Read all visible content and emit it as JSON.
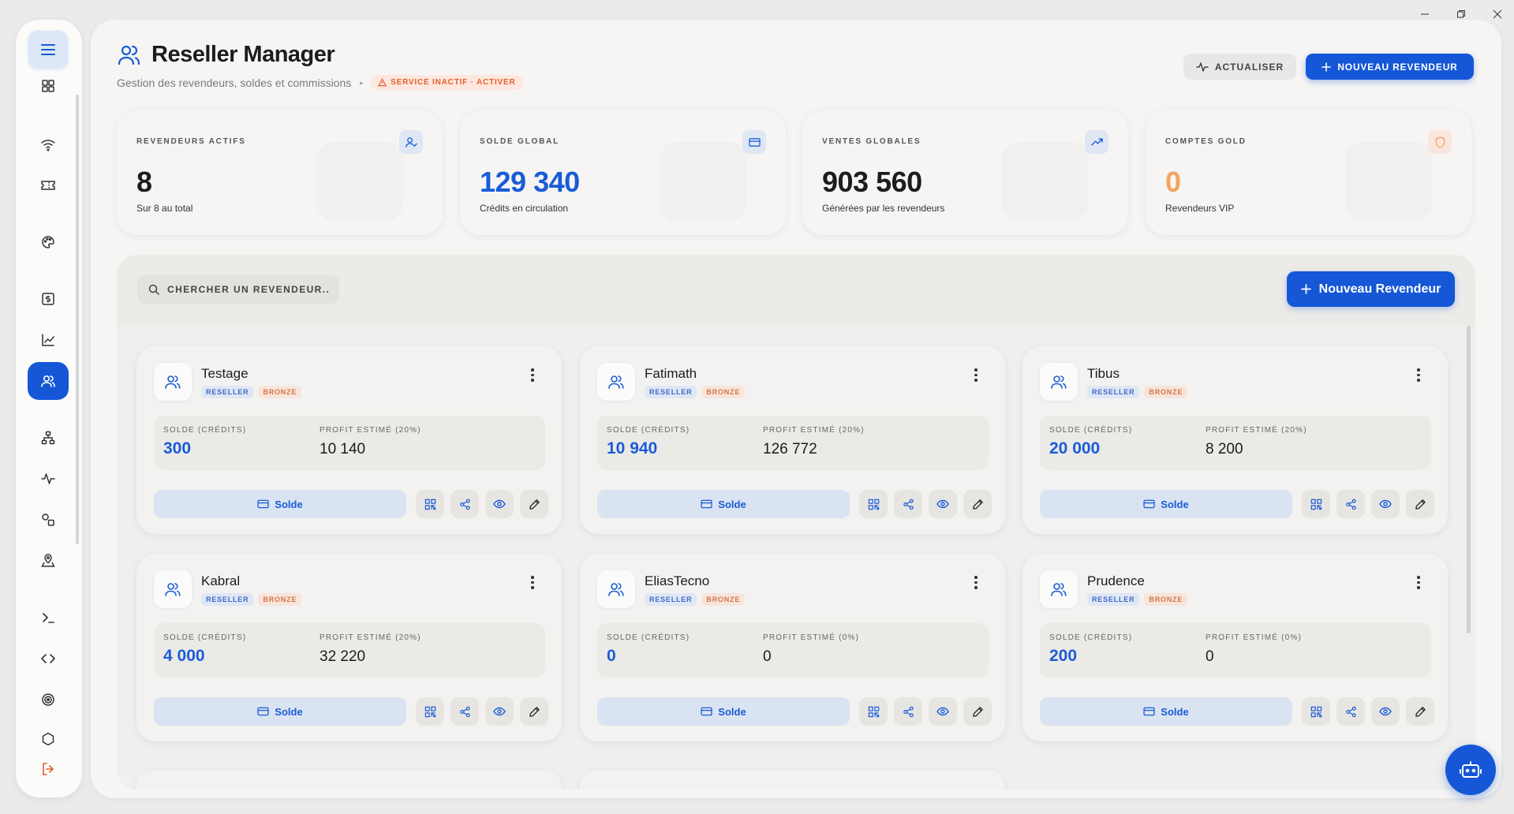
{
  "header": {
    "title": "Reseller Manager",
    "subtitle": "Gestion des revendeurs, soldes et commissions",
    "separator": "•",
    "service_badge": "SERVICE INACTIF · ACTIVER",
    "refresh_label": "ACTUALISER",
    "new_label": "NOUVEAU REVENDEUR"
  },
  "stats": [
    {
      "label": "REVENDEURS ACTIFS",
      "value": "8",
      "sub": "Sur 8 au total",
      "color": "#1c1c1c",
      "icon": "user-check-icon"
    },
    {
      "label": "SOLDE GLOBAL",
      "value": "129 340",
      "sub": "Crédits en circulation",
      "color": "#1a5cd8",
      "icon": "card-icon"
    },
    {
      "label": "VENTES GLOBALES",
      "value": "903 560",
      "sub": "Générées par les revendeurs",
      "color": "#1c1c1c",
      "icon": "trending-up-icon"
    },
    {
      "label": "COMPTES GOLD",
      "value": "0",
      "sub": "Revendeurs VIP",
      "color": "#f3a45c",
      "icon": "shield-icon"
    }
  ],
  "panel": {
    "search_placeholder": "CHERCHER UN REVENDEUR..",
    "new_button": "Nouveau Revendeur"
  },
  "labels": {
    "balance": "SOLDE (CRÉDITS)",
    "solde_button": "Solde"
  },
  "resellers": [
    {
      "name": "Testage",
      "role": "RESELLER",
      "tier": "BRONZE",
      "balance": "300",
      "profit_label": "PROFIT ESTIMÉ (20%)",
      "profit": "10 140"
    },
    {
      "name": "Fatimath",
      "role": "RESELLER",
      "tier": "BRONZE",
      "balance": "10 940",
      "profit_label": "PROFIT ESTIMÉ (20%)",
      "profit": "126 772"
    },
    {
      "name": "Tibus",
      "role": "RESELLER",
      "tier": "BRONZE",
      "balance": "20 000",
      "profit_label": "PROFIT ESTIMÉ (20%)",
      "profit": "8 200"
    },
    {
      "name": "Kabral",
      "role": "RESELLER",
      "tier": "BRONZE",
      "balance": "4 000",
      "profit_label": "PROFIT ESTIMÉ (20%)",
      "profit": "32 220"
    },
    {
      "name": "EliasTecno",
      "role": "RESELLER",
      "tier": "BRONZE",
      "balance": "0",
      "profit_label": "PROFIT ESTIMÉ (0%)",
      "profit": "0"
    },
    {
      "name": "Prudence",
      "role": "RESELLER",
      "tier": "BRONZE",
      "balance": "200",
      "profit_label": "PROFIT ESTIMÉ (0%)",
      "profit": "0"
    }
  ],
  "sidebar": {
    "items": [
      "dashboard-icon",
      "wifi-icon",
      "ticket-icon",
      "palette-icon",
      "dollar-icon",
      "chart-icon",
      "users-icon",
      "network-icon",
      "activity-icon",
      "shapes-icon",
      "map-pin-icon",
      "terminal-icon",
      "code-icon",
      "target-icon",
      "hexagon-icon",
      "logout-icon"
    ],
    "active": "users-icon"
  },
  "colors": {
    "accent": "#1557d6",
    "warning": "#e4602d",
    "gold": "#f3a45c"
  }
}
